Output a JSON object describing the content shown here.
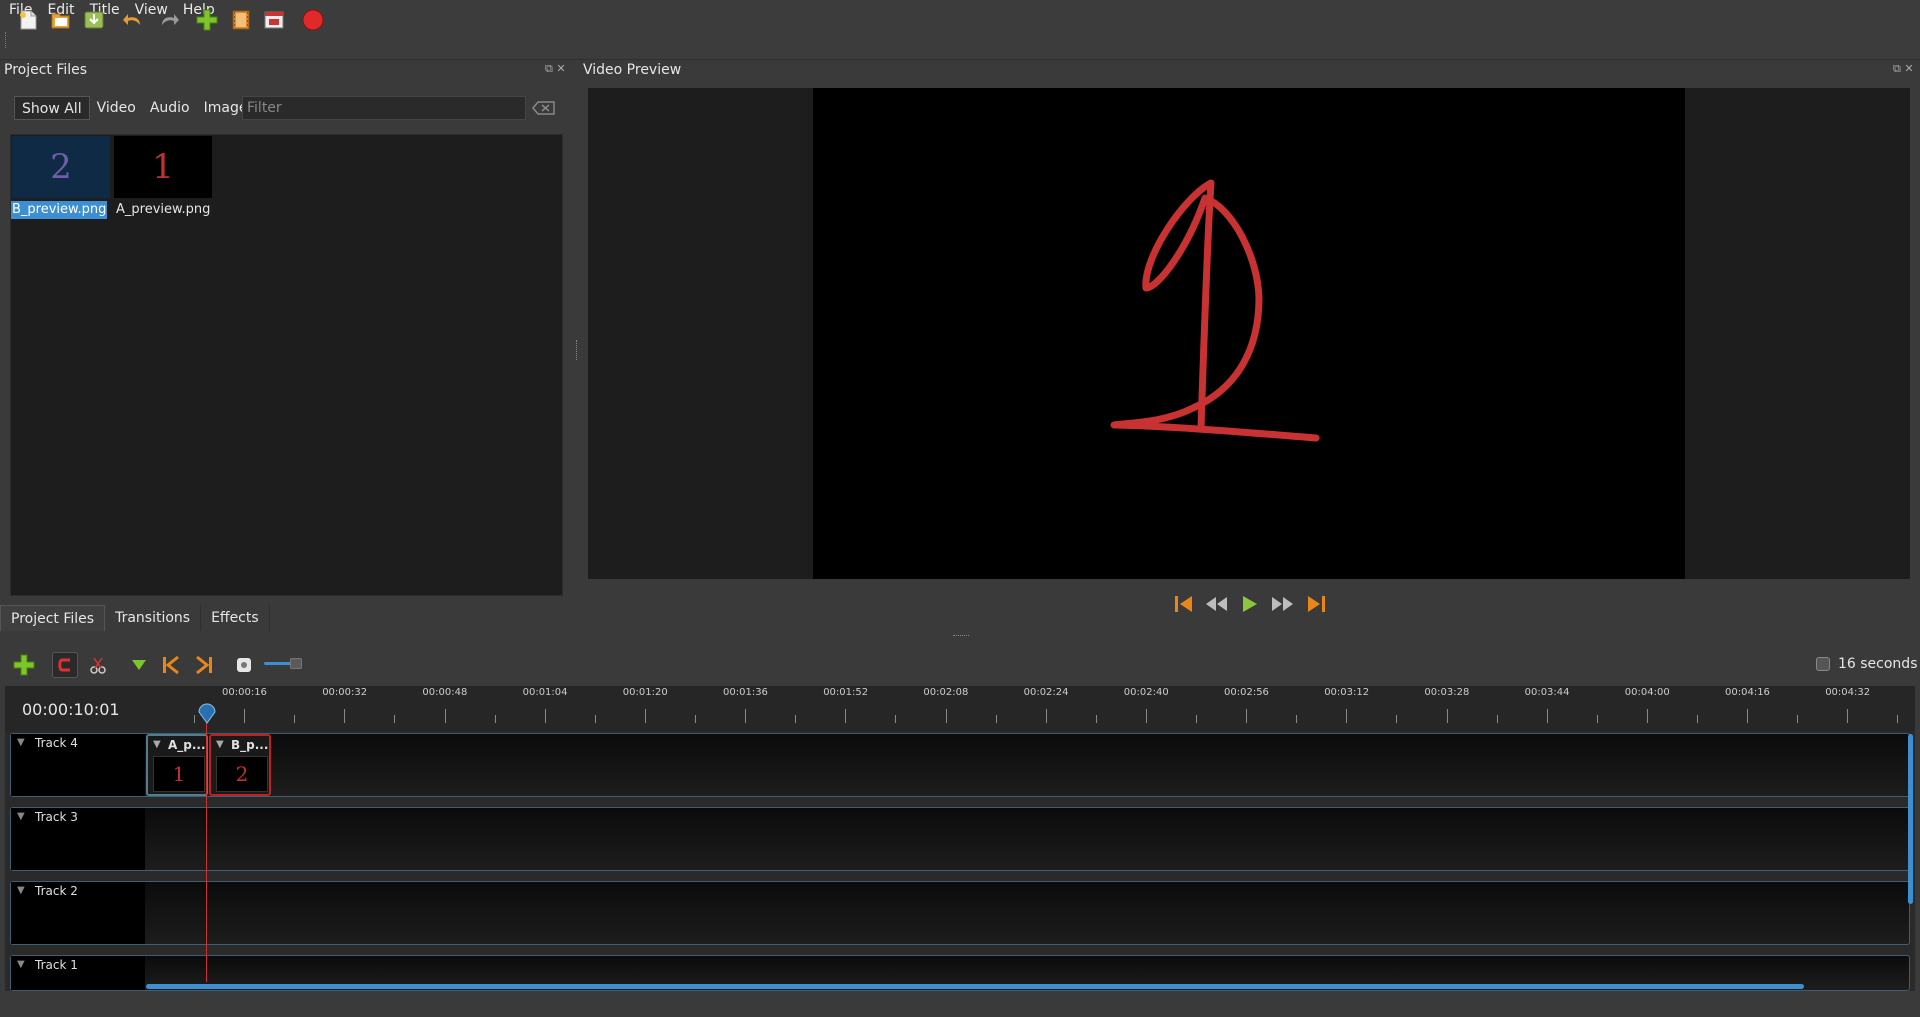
{
  "menu": [
    "File",
    "Edit",
    "Title",
    "View",
    "Help"
  ],
  "toolbar": {
    "icons": [
      "new-project-icon",
      "open-project-icon",
      "save-project-icon",
      "undo-icon",
      "redo-icon",
      "import-files-icon",
      "choose-profile-icon",
      "fullscreen-icon",
      "export-video-icon"
    ]
  },
  "project_files": {
    "title": "Project Files",
    "tabs": [
      "Show All",
      "Video",
      "Audio",
      "Image"
    ],
    "active_tab": "Show All",
    "filter_placeholder": "Filter",
    "files": [
      {
        "name": "B_preview.png",
        "glyph": "2",
        "selected": true
      },
      {
        "name": "A_preview.png",
        "glyph": "1",
        "selected": false
      }
    ]
  },
  "video_preview": {
    "title": "Video Preview"
  },
  "bottom_tabs": [
    "Project Files",
    "Transitions",
    "Effects"
  ],
  "timeline": {
    "timecode": "00:00:10:01",
    "zoom_label": "16 seconds",
    "ruler_labels": [
      "00:00:16",
      "00:00:32",
      "00:00:48",
      "00:01:04",
      "00:01:20",
      "00:01:36",
      "00:01:52",
      "00:02:08",
      "00:02:24",
      "00:02:40",
      "00:02:56",
      "00:03:12",
      "00:03:28",
      "00:03:44",
      "00:04:00",
      "00:04:16",
      "00:04:32"
    ],
    "tracks": [
      "Track 4",
      "Track 3",
      "Track 2",
      "Track 1"
    ],
    "clips": [
      {
        "title": "A_p...",
        "glyph": "1",
        "track": "Track 4"
      },
      {
        "title": "B_p...",
        "glyph": "2",
        "track": "Track 4"
      }
    ]
  },
  "colors": {
    "accent": "#3d8fd4",
    "playhead": "#d03030",
    "clip_a_border": "#4f7f8f",
    "clip_b_border": "#c02020"
  }
}
